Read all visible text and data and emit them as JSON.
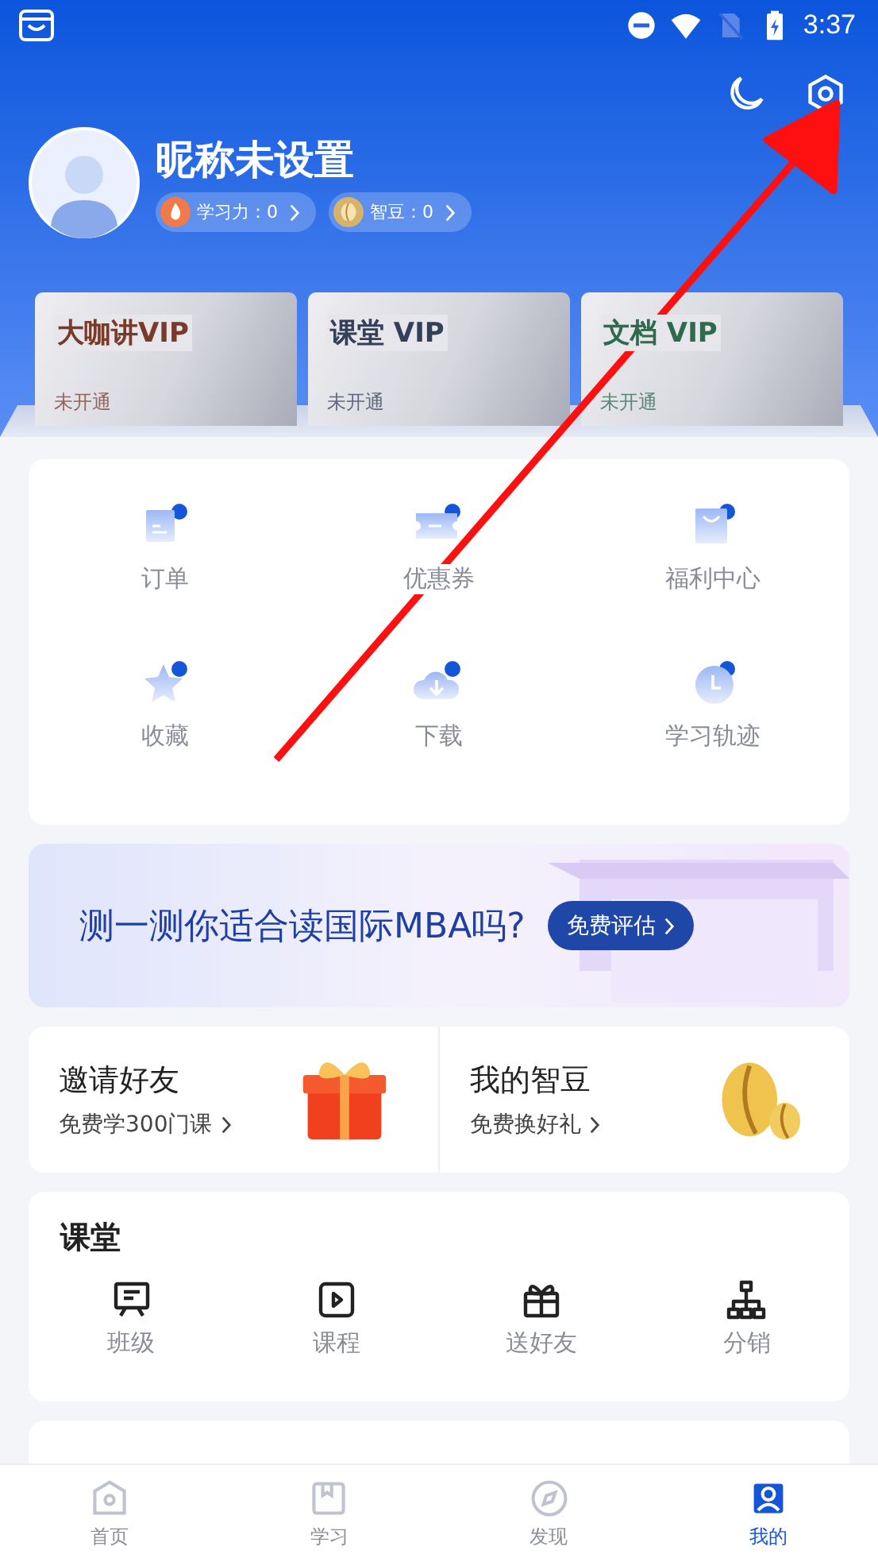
{
  "status_bar": {
    "time": "3:37"
  },
  "profile": {
    "nickname": "昵称未设置",
    "badges": [
      {
        "kind": "flame",
        "label": "学习力：0"
      },
      {
        "kind": "bean",
        "label": "智豆：0"
      }
    ]
  },
  "vip_cards": [
    {
      "title": "大咖讲VIP",
      "status": "未开通",
      "color": "#7a3a2a"
    },
    {
      "title": "课堂 VIP",
      "status": "未开通",
      "color": "#34405a"
    },
    {
      "title": "文档 VIP",
      "status": "未开通",
      "color": "#2e6a4e"
    }
  ],
  "shortcuts": [
    {
      "kind": "order",
      "label": "订单"
    },
    {
      "kind": "coupon",
      "label": "优惠券"
    },
    {
      "kind": "bag",
      "label": "福利中心"
    },
    {
      "kind": "star",
      "label": "收藏"
    },
    {
      "kind": "download",
      "label": "下载"
    },
    {
      "kind": "clock",
      "label": "学习轨迹"
    }
  ],
  "banner": {
    "text": "测一测你适合读国际MBA吗?",
    "button": "免费评估"
  },
  "promos": [
    {
      "kind": "gift",
      "title": "邀请好友",
      "subtitle": "免费学300门课"
    },
    {
      "kind": "bean",
      "title": "我的智豆",
      "subtitle": "免费换好礼"
    }
  ],
  "classroom": {
    "title": "课堂",
    "items": [
      {
        "kind": "class",
        "label": "班级"
      },
      {
        "kind": "course",
        "label": "课程"
      },
      {
        "kind": "gift",
        "label": "送好友"
      },
      {
        "kind": "tree",
        "label": "分销"
      }
    ]
  },
  "tabs": [
    {
      "kind": "home",
      "label": "首页",
      "selected": false
    },
    {
      "kind": "study",
      "label": "学习",
      "selected": false
    },
    {
      "kind": "discover",
      "label": "发现",
      "selected": false
    },
    {
      "kind": "mine",
      "label": "我的",
      "selected": true
    }
  ]
}
